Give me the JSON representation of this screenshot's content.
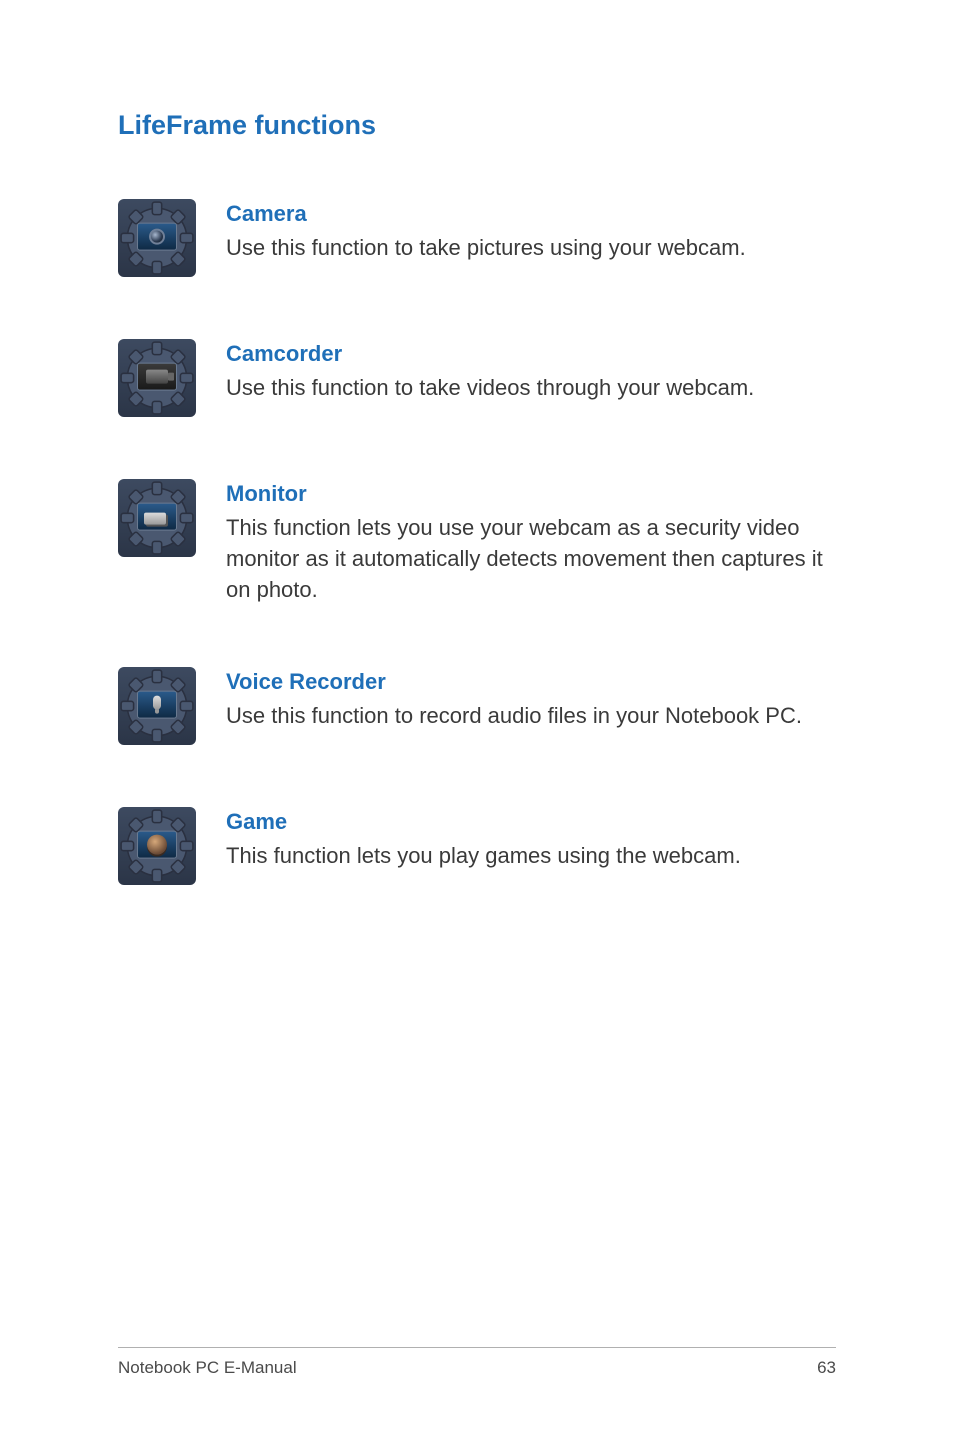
{
  "section_title": "LifeFrame functions",
  "items": [
    {
      "title": "Camera",
      "description": "Use this function to take pictures using your webcam."
    },
    {
      "title": "Camcorder",
      "description": "Use this function to take videos through your webcam."
    },
    {
      "title": "Monitor",
      "description": "This function lets you use your webcam as a security video monitor as it automatically detects movement then captures it on photo."
    },
    {
      "title": "Voice Recorder",
      "description": "Use this function to record audio files in your Notebook PC."
    },
    {
      "title": "Game",
      "description": "This function lets you play games using the webcam."
    }
  ],
  "footer": {
    "left": "Notebook PC E-Manual",
    "right": "63"
  }
}
